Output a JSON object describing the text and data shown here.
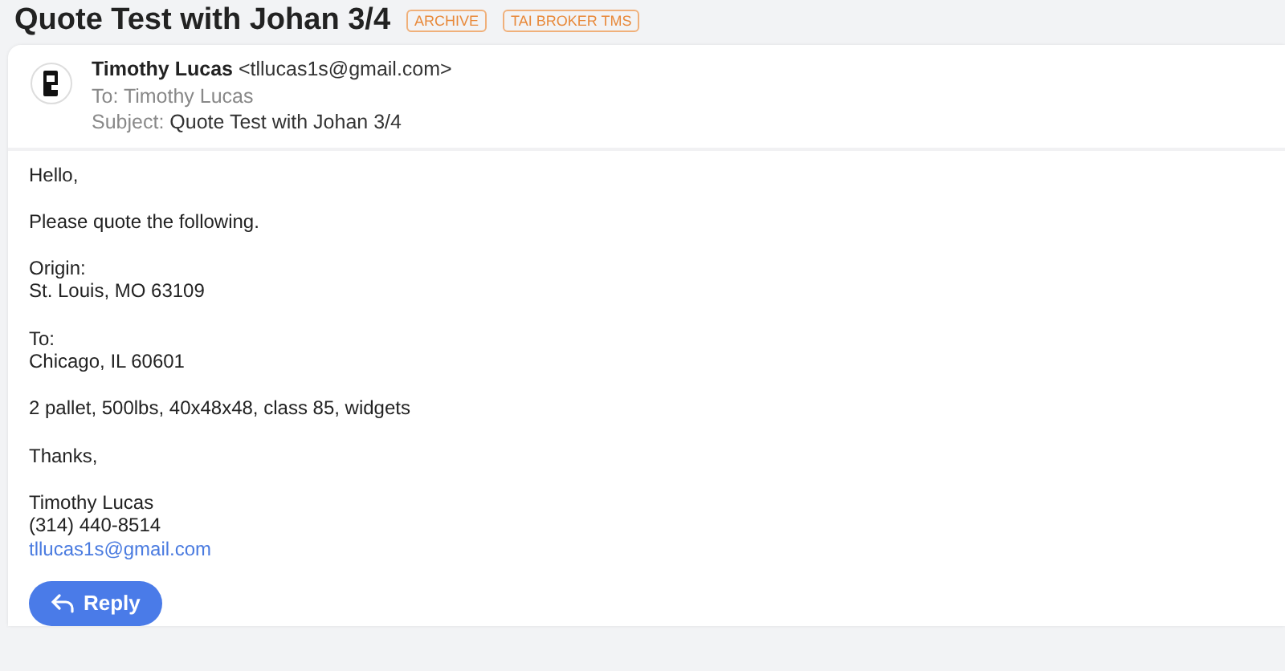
{
  "title": "Quote Test with Johan 3/4",
  "tags": [
    "ARCHIVE",
    "TAI BROKER TMS"
  ],
  "message": {
    "from_name": "Timothy Lucas",
    "from_email": "<tllucas1s@gmail.com>",
    "to_label": "To:",
    "to": "Timothy Lucas",
    "subject_label": "Subject:",
    "subject": "Quote Test with Johan 3/4",
    "body": [
      {
        "lines": [
          {
            "kind": "text",
            "text": "Hello,"
          }
        ]
      },
      {
        "lines": [
          {
            "kind": "text",
            "text": "Please quote the following."
          }
        ]
      },
      {
        "lines": [
          {
            "kind": "text",
            "text": "Origin:"
          },
          {
            "kind": "text",
            "text": "St. Louis, MO 63109"
          }
        ]
      },
      {
        "lines": [
          {
            "kind": "text",
            "text": "To:"
          },
          {
            "kind": "text",
            "text": "Chicago, IL 60601"
          }
        ]
      },
      {
        "lines": [
          {
            "kind": "text",
            "text": "2 pallet, 500lbs, 40x48x48, class 85, widgets"
          }
        ]
      },
      {
        "lines": [
          {
            "kind": "text",
            "text": "Thanks,"
          }
        ]
      },
      {
        "lines": [
          {
            "kind": "text",
            "text": "Timothy Lucas"
          },
          {
            "kind": "text",
            "text": "(314) 440-8514"
          },
          {
            "kind": "link",
            "text": "tllucas1s@gmail.com"
          }
        ]
      }
    ]
  },
  "reply_button": "Reply"
}
